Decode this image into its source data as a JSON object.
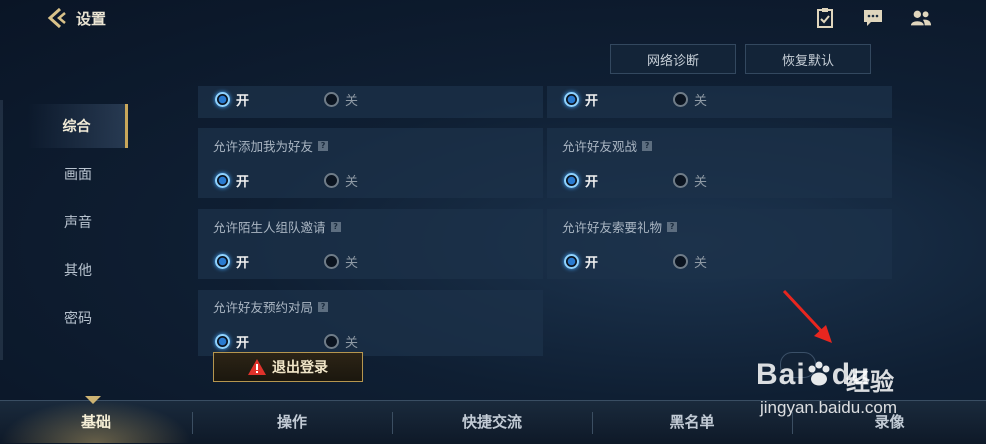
{
  "header": {
    "title": "设置"
  },
  "top_buttons": {
    "network": "网络诊断",
    "reset": "恢复默认"
  },
  "sidebar": {
    "items": [
      {
        "label": "综合"
      },
      {
        "label": "画面"
      },
      {
        "label": "声音"
      },
      {
        "label": "其他"
      },
      {
        "label": "密码"
      }
    ]
  },
  "settings": {
    "top_left": {
      "on": "开",
      "off": "关",
      "selected": "on"
    },
    "top_right": {
      "on": "开",
      "off": "关",
      "selected": "on"
    },
    "add_friend": {
      "title": "允许添加我为好友",
      "help": "?",
      "on": "开",
      "off": "关",
      "selected": "on"
    },
    "watch_friend": {
      "title": "允许好友观战",
      "help": "?",
      "on": "开",
      "off": "关",
      "selected": "on"
    },
    "stranger_invite": {
      "title": "允许陌生人组队邀请",
      "help": "?",
      "on": "开",
      "off": "关",
      "selected": "on"
    },
    "gift_request": {
      "title": "允许好友索要礼物",
      "help": "?",
      "on": "开",
      "off": "关",
      "selected": "on"
    },
    "reserve_match": {
      "title": "允许好友预约对局",
      "help": "?",
      "on": "开",
      "off": "关",
      "selected": "on"
    }
  },
  "logout": {
    "label": "退出登录"
  },
  "bottom_tabs": [
    {
      "label": "基础"
    },
    {
      "label": "操作"
    },
    {
      "label": "快捷交流"
    },
    {
      "label": "黑名单"
    },
    {
      "label": "录像"
    }
  ],
  "watermark": {
    "logo": "Bai",
    "logo2": "du",
    "brand": "经验",
    "url": "jingyan.baidu.com"
  },
  "colors": {
    "accent_gold": "#c9a75a",
    "radio_on": "#2a7bd0"
  }
}
